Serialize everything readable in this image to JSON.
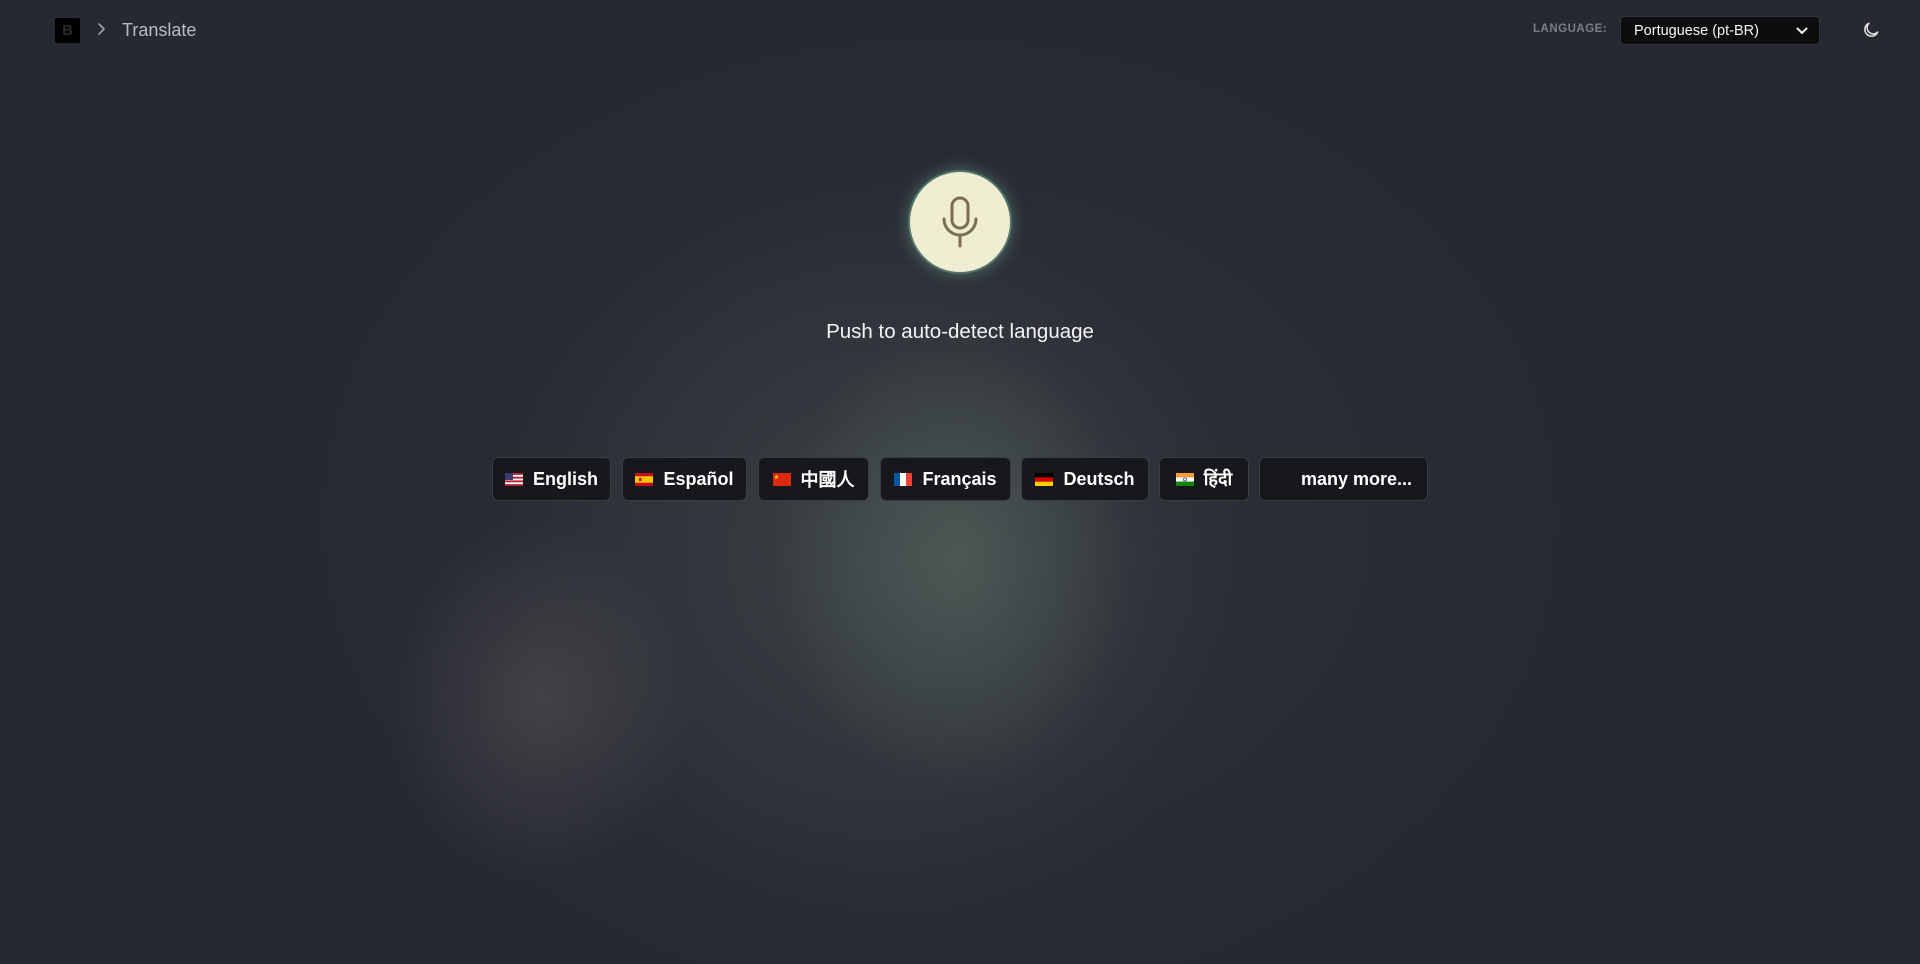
{
  "header": {
    "logo_letter": "B",
    "breadcrumb_title": "Translate",
    "language_label": "LANGUAGE:",
    "language_selected": "Portuguese (pt-BR)",
    "theme_icon": "moon-icon"
  },
  "main": {
    "mic_icon": "microphone-icon",
    "push_label": "Push to auto-detect language",
    "languages": [
      {
        "label": "English",
        "flag": "us-flag-icon"
      },
      {
        "label": "Español",
        "flag": "spain-flag-icon"
      },
      {
        "label": "中國人",
        "flag": "china-flag-icon"
      },
      {
        "label": "Français",
        "flag": "france-flag-icon"
      },
      {
        "label": "Deutsch",
        "flag": "germany-flag-icon"
      },
      {
        "label": "हिंदी",
        "flag": "india-flag-icon"
      }
    ],
    "more_label": "many more..."
  },
  "colors": {
    "background": "#262832",
    "mic_fill": "#f0eed2",
    "mic_glow": "#78be a0",
    "chip_bg": "#17181c"
  }
}
